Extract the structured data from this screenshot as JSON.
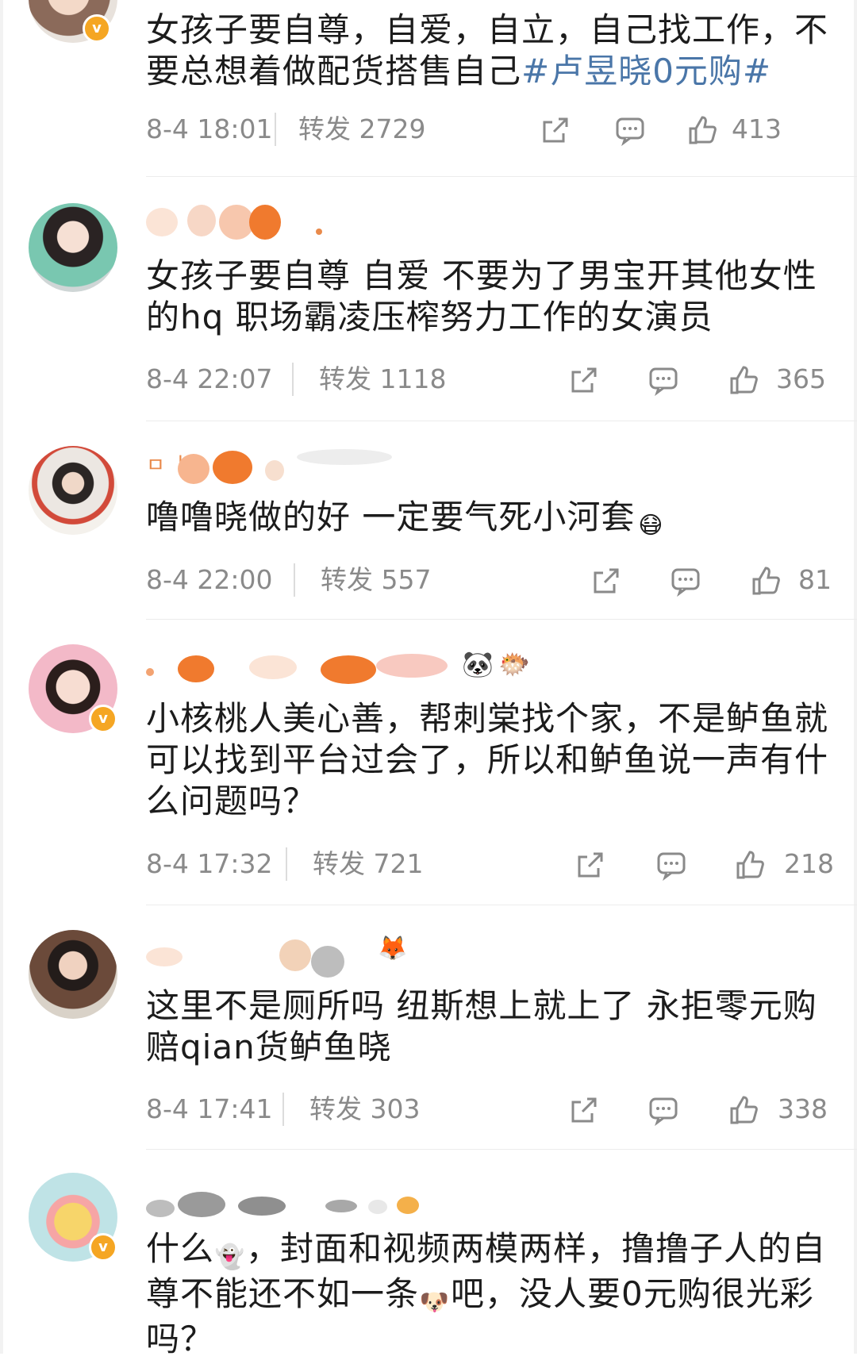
{
  "comments": [
    {
      "text": "女孩子要自尊，自爱，自立，自己找工作，不要总想着做配货搭售自己",
      "hashtag": "#卢昱晓0元购#",
      "time": "8-4 18:01",
      "repost": "转发 2729",
      "likes": "413"
    },
    {
      "text": "女孩子要自尊 自爱 不要为了男宝开其他女性的hq 职场霸凌压榨努力工作的女演员",
      "time": "8-4 22:07",
      "repost": "转发 1118",
      "likes": "365"
    },
    {
      "text": "噜噜晓做的好 一定要气死小河套",
      "emoji": "😷",
      "time": "8-4 22:00",
      "repost": "转发 557",
      "likes": "81"
    },
    {
      "text": "小核桃人美心善，帮刺棠找个家，不是鲈鱼就可以找到平台过会了，所以和鲈鱼说一声有什么问题吗？",
      "time": "8-4 17:32",
      "repost": "转发 721",
      "likes": "218"
    },
    {
      "text": "这里不是厕所吗 纽斯想上就上了 永拒零元购赔qian货鲈鱼晓",
      "time": "8-4 17:41",
      "repost": "转发 303",
      "likes": "338"
    },
    {
      "text_a": "什么",
      "emoji_a": "👻",
      "text_b": "，封面和视频两模两样，撸撸子人的自尊不能还不如一条",
      "emoji_b": "🐶",
      "text_c": "吧，没人要0元购很光彩吗？"
    }
  ],
  "colors": {
    "hashtag": "#4a76a8",
    "meta": "#8a8a8a",
    "badge": "#f5a623"
  },
  "icons": [
    "share-icon",
    "comment-icon",
    "like-icon"
  ]
}
